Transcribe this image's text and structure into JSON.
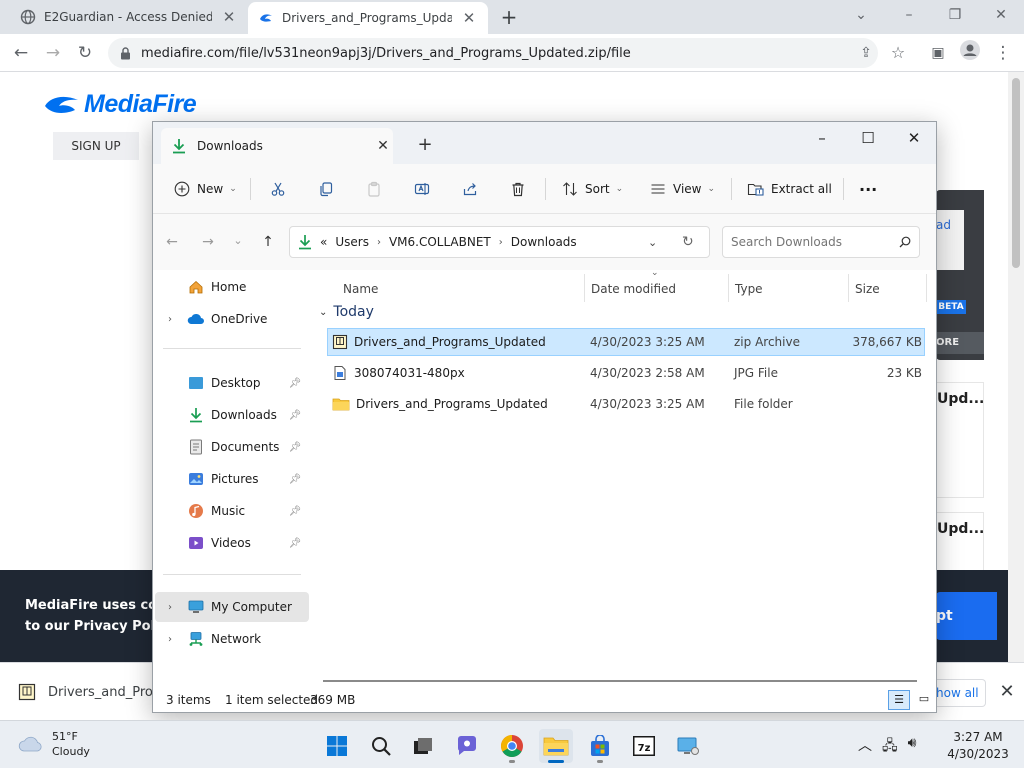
{
  "browser": {
    "tabs": [
      {
        "title": "E2Guardian - Access Denied",
        "active": false
      },
      {
        "title": "Drivers_and_Programs_Updated",
        "active": true
      }
    ],
    "url": "mediafire.com/file/lv531neon9apj3j/Drivers_and_Programs_Updated.zip/file"
  },
  "page": {
    "logo_text": "MediaFire",
    "signup_label": "SIGN UP",
    "panel_ad_text": "ad",
    "panel_beta": "BETA",
    "panel_more": "ORE",
    "upd_card_1": "Upd...",
    "upd_card_2": "Upd...",
    "cookie_line1": "MediaFire uses cooki",
    "cookie_line2": "to our Privacy Policy.",
    "cookie_accept": "pt"
  },
  "download_bar": {
    "filename": "Drivers_and_Prog",
    "show_all": "how all"
  },
  "explorer": {
    "tab_title": "Downloads",
    "toolbar": {
      "new_label": "New",
      "sort_label": "Sort",
      "view_label": "View",
      "extract_label": "Extract all",
      "more_label": "···"
    },
    "breadcrumb": {
      "overflow": "«",
      "parts": [
        "Users",
        "VM6.COLLABNET",
        "Downloads"
      ]
    },
    "search_placeholder": "Search Downloads",
    "sidebar": [
      {
        "label": "Home"
      },
      {
        "label": "OneDrive"
      },
      {
        "label": "Desktop"
      },
      {
        "label": "Downloads"
      },
      {
        "label": "Documents"
      },
      {
        "label": "Pictures"
      },
      {
        "label": "Music"
      },
      {
        "label": "Videos"
      },
      {
        "label": "My Computer"
      },
      {
        "label": "Network"
      }
    ],
    "columns": {
      "name": "Name",
      "date": "Date modified",
      "type": "Type",
      "size": "Size"
    },
    "group": "Today",
    "files": [
      {
        "name": "Drivers_and_Programs_Updated",
        "date": "4/30/2023 3:25 AM",
        "type": "zip Archive",
        "size": "378,667 KB",
        "icon": "zip-icon",
        "selected": true
      },
      {
        "name": "308074031-480px",
        "date": "4/30/2023 2:58 AM",
        "type": "JPG File",
        "size": "23 KB",
        "icon": "image-file-icon",
        "selected": false
      },
      {
        "name": "Drivers_and_Programs_Updated",
        "date": "4/30/2023 3:25 AM",
        "type": "File folder",
        "size": "",
        "icon": "folder-icon",
        "selected": false
      }
    ],
    "status": {
      "count": "3 items",
      "selected": "1 item selected",
      "size": "369 MB"
    }
  },
  "taskbar": {
    "weather_temp": "51°F",
    "weather_desc": "Cloudy",
    "time": "3:27 AM",
    "date": "4/30/2023"
  },
  "colors": {
    "accent": "#0067c0",
    "selection": "#cce8ff",
    "mediafire_blue": "#0070f0"
  }
}
